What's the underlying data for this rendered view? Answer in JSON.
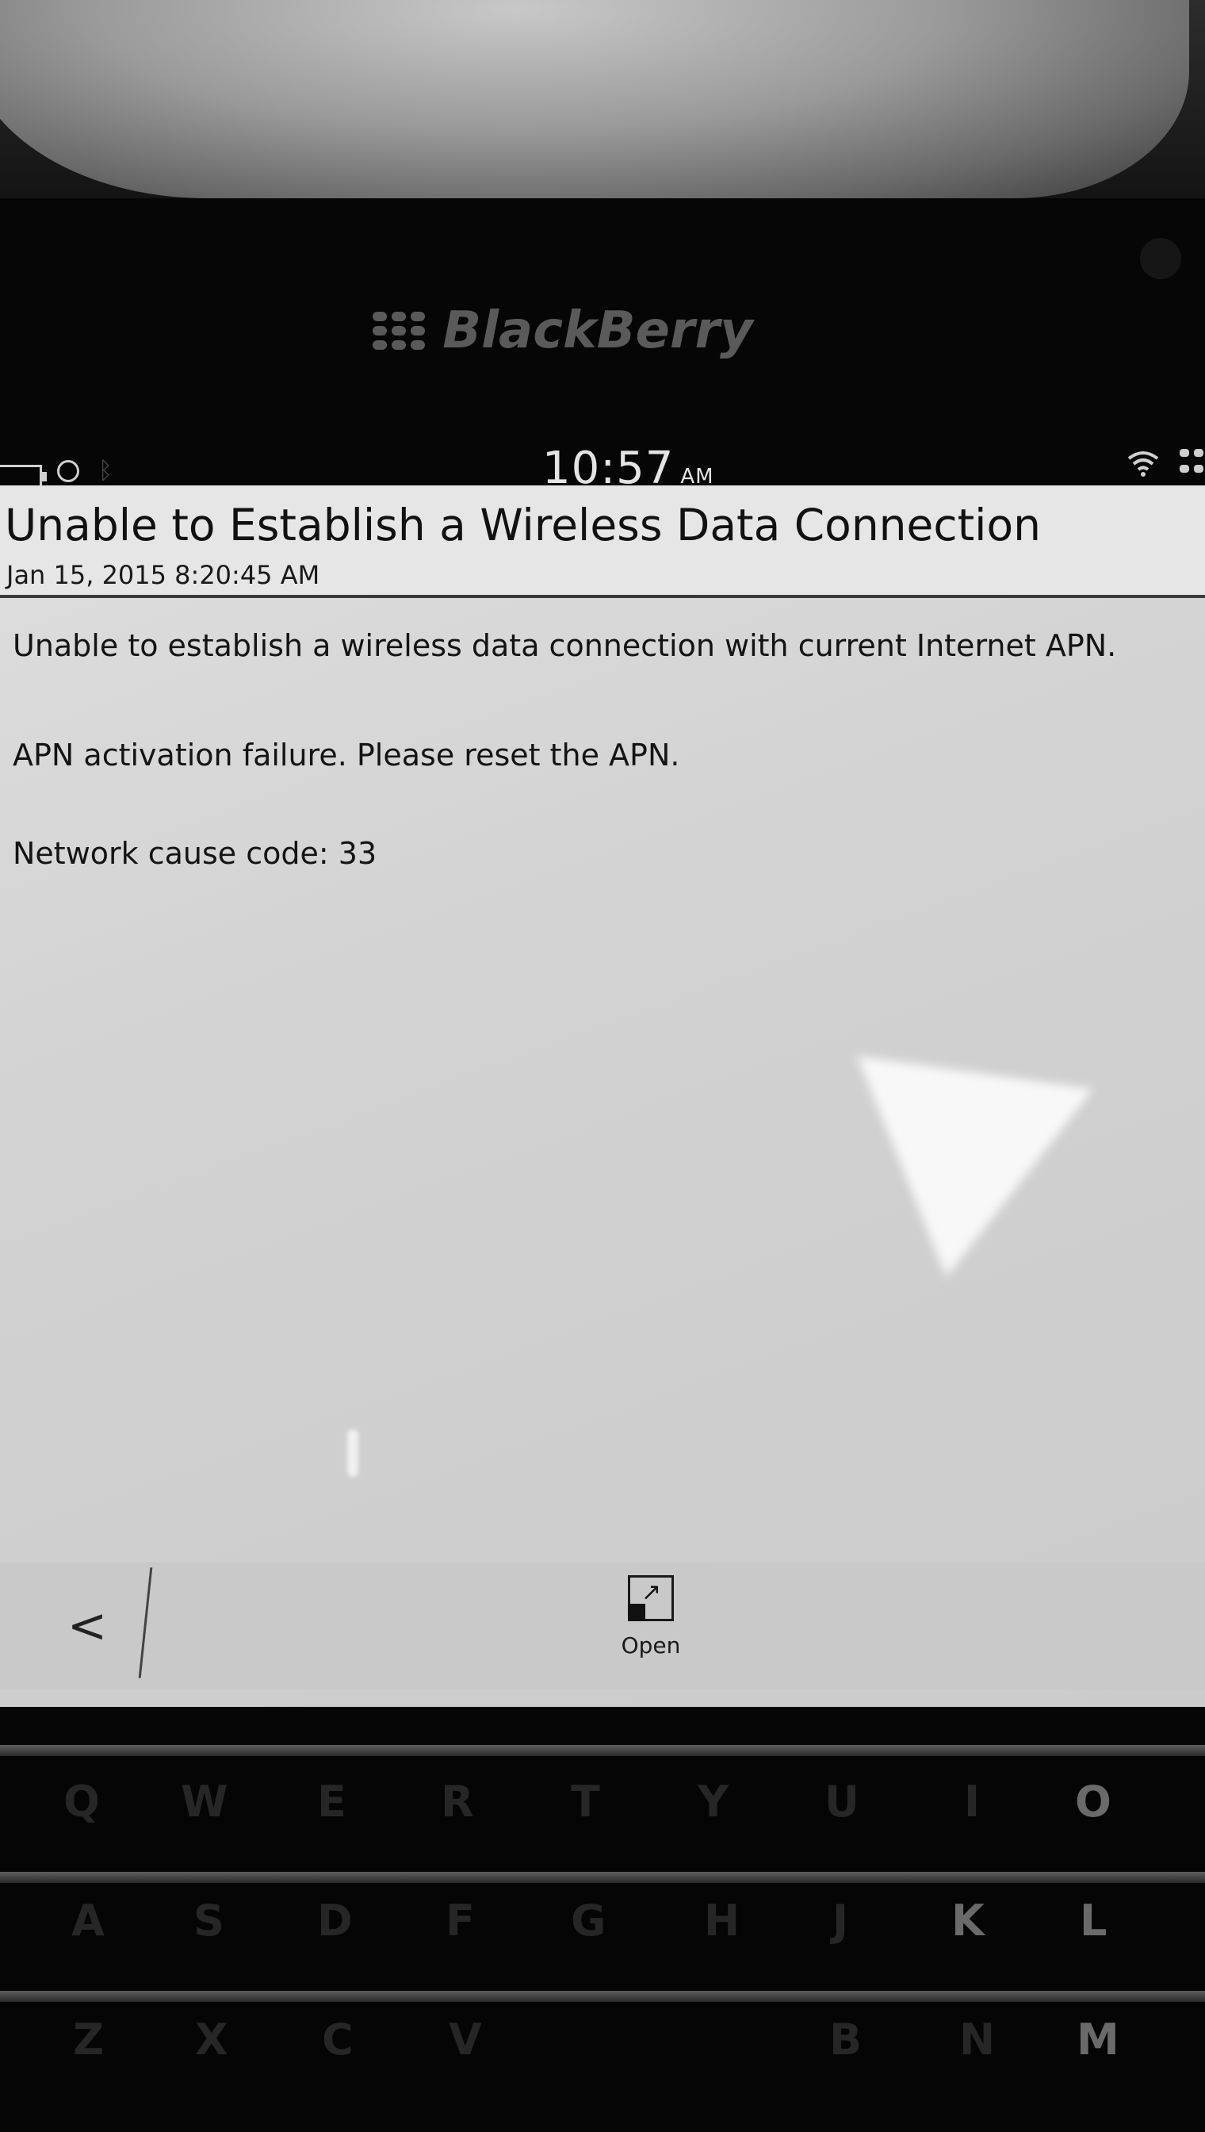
{
  "device": {
    "brand": "BlackBerry"
  },
  "status_bar": {
    "time": "10:57",
    "ampm": "AM",
    "icons": [
      "battery-icon",
      "alarm-icon",
      "bluetooth-icon",
      "wifi-icon",
      "network-icon"
    ]
  },
  "notification": {
    "title": "Unable to Establish a Wireless Data Connection",
    "timestamp": "Jan 15, 2015 8:20:45 AM",
    "lines": [
      "Unable to establish a wireless data connection with current Internet APN.",
      "APN activation failure. Please reset the APN.",
      "Network cause code: 33"
    ]
  },
  "action_bar": {
    "back_label": "<",
    "open_label": "Open"
  },
  "keyboard": {
    "row1": [
      "Q",
      "W",
      "E",
      "R",
      "T",
      "Y",
      "U",
      "I",
      "O"
    ],
    "row2": [
      "A",
      "S",
      "D",
      "F",
      "G",
      "H",
      "J",
      "K",
      "L"
    ],
    "row3": [
      "Z",
      "X",
      "C",
      "V",
      "B",
      "N",
      "M"
    ]
  },
  "colors": {
    "screen_bg": "#d6d6d6",
    "text": "#141414",
    "device_body": "#060606"
  }
}
